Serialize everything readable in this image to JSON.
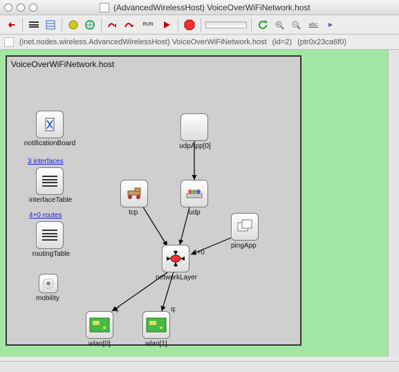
{
  "window": {
    "title": "(AdvancedWirelessHost) VoiceOverWiFiNetwork.host"
  },
  "breadcrumb": {
    "path": "(inet.nodes.wireless.AdvancedWirelessHost) VoiceOverWiFiNetwork.host",
    "id": "(id=2)",
    "ptr": "(ptr0x23ca6f0)"
  },
  "module": {
    "title": "VoiceOverWiFiNetwork.host"
  },
  "nodes": {
    "notificationBoard": "notificationBoard",
    "udpApp": "udpApp[0]",
    "interfaceTable": "interfaceTable",
    "interfaceTableLink": "3 interfaces",
    "tcp": "tcp",
    "udp": "udp",
    "routingTable": "routingTable",
    "routingTableLink": "4+0 routes",
    "pingApp": "pingApp",
    "networkLayer": "networkLayer",
    "networkLayerCount": "4+0",
    "mobility": "mobility",
    "wlan0": "wlan[0]",
    "wlan0q": "q:",
    "wlan1": "wlan[1]",
    "wlan1q": "q:"
  },
  "toolbar": {
    "back": "back",
    "listview1": "listview1",
    "listview2": "listview2",
    "nav1": "nav",
    "nav2": "nav2",
    "stepBack": "stepBack",
    "stepOver": "stepOver",
    "run": "RUN",
    "play": "play",
    "stop": "stop",
    "refresh": "refresh",
    "zoomIn": "zoomIn",
    "zoomOut": "zoomOut",
    "abc": "abc",
    "more": "more"
  }
}
